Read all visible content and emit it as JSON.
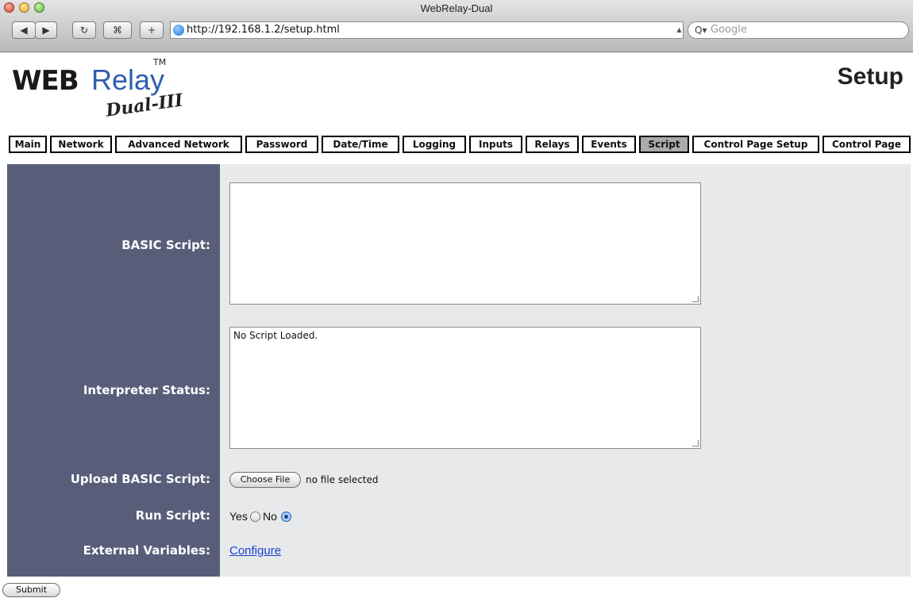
{
  "window": {
    "title": "WebRelay-Dual"
  },
  "toolbar": {
    "back": "◀",
    "forward": "▶",
    "reload": "↻",
    "snap": "⌘",
    "add": "+",
    "url": "http://192.168.1.2/setup.html",
    "search_placeholder": "Google",
    "search_icon": "Q▾"
  },
  "logo": {
    "web": "WEB",
    "relay": "Relay",
    "tm": "TM",
    "model": "Dual-III"
  },
  "page": {
    "title": "Setup"
  },
  "nav": {
    "tabs": [
      {
        "label": "Main"
      },
      {
        "label": "Network"
      },
      {
        "label": "Advanced Network"
      },
      {
        "label": "Password"
      },
      {
        "label": "Date/Time"
      },
      {
        "label": "Logging"
      },
      {
        "label": "Inputs"
      },
      {
        "label": "Relays"
      },
      {
        "label": "Events"
      },
      {
        "label": "Script",
        "active": true
      },
      {
        "label": "Control Page Setup"
      },
      {
        "label": "Control Page"
      }
    ]
  },
  "form": {
    "basic_script": {
      "label": "BASIC Script:",
      "value": ""
    },
    "interpreter_status": {
      "label": "Interpreter Status:",
      "value": "No Script Loaded."
    },
    "upload": {
      "label": "Upload BASIC Script:",
      "button": "Choose File",
      "status": "no file selected"
    },
    "run_script": {
      "label": "Run Script:",
      "yes": "Yes",
      "no": "No",
      "selected": "No"
    },
    "external_variables": {
      "label": "External Variables:",
      "link": "Configure"
    },
    "submit": "Submit"
  }
}
